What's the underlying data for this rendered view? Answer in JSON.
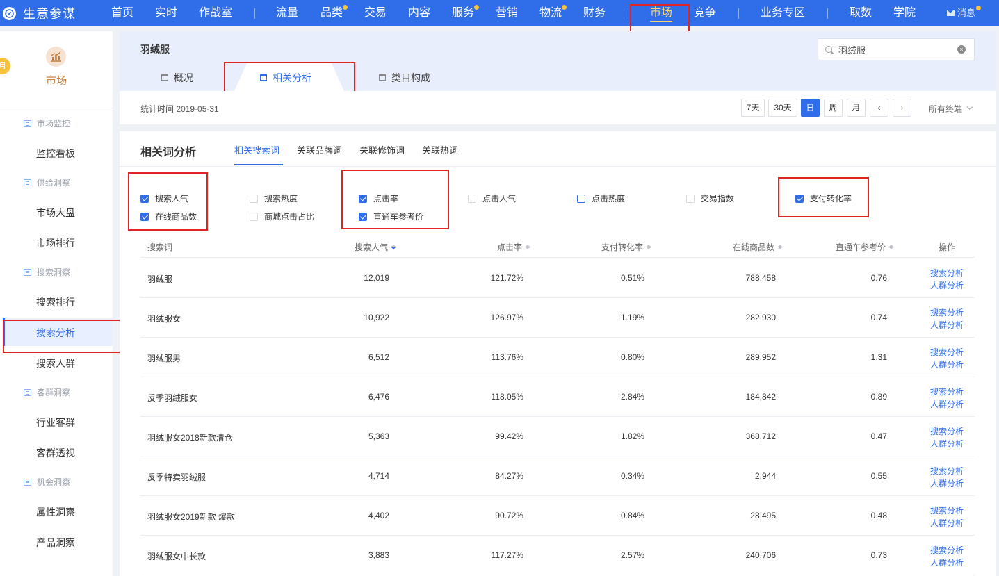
{
  "brand": {
    "name": "生意参谋"
  },
  "nav": {
    "home": "首页",
    "realtime": "实时",
    "warroom": "作战室",
    "traffic": "流量",
    "category": "品类",
    "trade": "交易",
    "content": "内容",
    "service": "服务",
    "marketing": "营销",
    "logistics": "物流",
    "finance": "财务",
    "market": "市场",
    "compete": "竞争",
    "business": "业务专区",
    "data": "取数",
    "academy": "学院",
    "message": "消息"
  },
  "sidebar": {
    "tag": "月",
    "title": "市场",
    "groups": {
      "monitor": "市场监控",
      "supply": "供给洞察",
      "search": "搜索洞察",
      "customer": "客群洞察",
      "opportunity": "机会洞察"
    },
    "items": {
      "monitor_board": "监控看板",
      "market_overview": "市场大盘",
      "market_rank": "市场排行",
      "search_rank": "搜索排行",
      "search_analysis": "搜索分析",
      "search_people": "搜索人群",
      "industry_customer": "行业客群",
      "customer_view": "客群透视",
      "attribute": "属性洞察",
      "product": "产品洞察"
    }
  },
  "header": {
    "keyword": "羽绒服",
    "search_value": "羽绒服",
    "tabs": {
      "overview": "概况",
      "related": "相关分析",
      "composition": "类目构成"
    }
  },
  "datebar": {
    "stat_time": "统计时间 2019-05-31",
    "btn_7d": "7天",
    "btn_30d": "30天",
    "btn_day": "日",
    "btn_week": "周",
    "btn_month": "月",
    "terminal": "所有终端"
  },
  "analysis": {
    "title": "相关词分析",
    "tabs": {
      "search": "相关搜索词",
      "brand": "关联品牌词",
      "modifier": "关联修饰词",
      "hot": "关联热词"
    },
    "metrics": {
      "search_pop": "搜索人气",
      "online_goods": "在线商品数",
      "search_heat": "搜索热度",
      "mall_click": "商城点击占比",
      "ctr": "点击率",
      "ztc_price": "直通车参考价",
      "click_pop": "点击人气",
      "click_heat": "点击热度",
      "trade_index": "交易指数",
      "pay_conv": "支付转化率"
    }
  },
  "table": {
    "headers": {
      "keyword": "搜索词",
      "search_pop": "搜索人气",
      "ctr": "点击率",
      "pay_conv": "支付转化率",
      "online_goods": "在线商品数",
      "ztc_price": "直通车参考价",
      "action": "操作"
    },
    "actions": {
      "search_analysis": "搜索分析",
      "people_analysis": "人群分析"
    },
    "rows": [
      {
        "keyword": "羽绒服",
        "search_pop": "12,019",
        "ctr": "121.72%",
        "pay_conv": "0.51%",
        "online_goods": "788,458",
        "ztc_price": "0.76"
      },
      {
        "keyword": "羽绒服女",
        "search_pop": "10,922",
        "ctr": "126.97%",
        "pay_conv": "1.19%",
        "online_goods": "282,930",
        "ztc_price": "0.74"
      },
      {
        "keyword": "羽绒服男",
        "search_pop": "6,512",
        "ctr": "113.76%",
        "pay_conv": "0.80%",
        "online_goods": "289,952",
        "ztc_price": "1.31"
      },
      {
        "keyword": "反季羽绒服女",
        "search_pop": "6,476",
        "ctr": "118.05%",
        "pay_conv": "2.84%",
        "online_goods": "184,842",
        "ztc_price": "0.89"
      },
      {
        "keyword": "羽绒服女2018新款清仓",
        "search_pop": "5,363",
        "ctr": "99.42%",
        "pay_conv": "1.82%",
        "online_goods": "368,712",
        "ztc_price": "0.47"
      },
      {
        "keyword": "反季特卖羽绒服",
        "search_pop": "4,714",
        "ctr": "84.27%",
        "pay_conv": "0.34%",
        "online_goods": "2,944",
        "ztc_price": "0.55"
      },
      {
        "keyword": "羽绒服女2019新款 爆款",
        "search_pop": "4,402",
        "ctr": "90.72%",
        "pay_conv": "0.84%",
        "online_goods": "28,495",
        "ztc_price": "0.48"
      },
      {
        "keyword": "羽绒服女中长款",
        "search_pop": "3,883",
        "ctr": "117.27%",
        "pay_conv": "2.57%",
        "online_goods": "240,706",
        "ztc_price": "0.73"
      }
    ]
  },
  "colors": {
    "primary": "#2f6ee8",
    "accent": "#f7d47a",
    "highlight": "#e02424",
    "market": "#c57a36"
  }
}
